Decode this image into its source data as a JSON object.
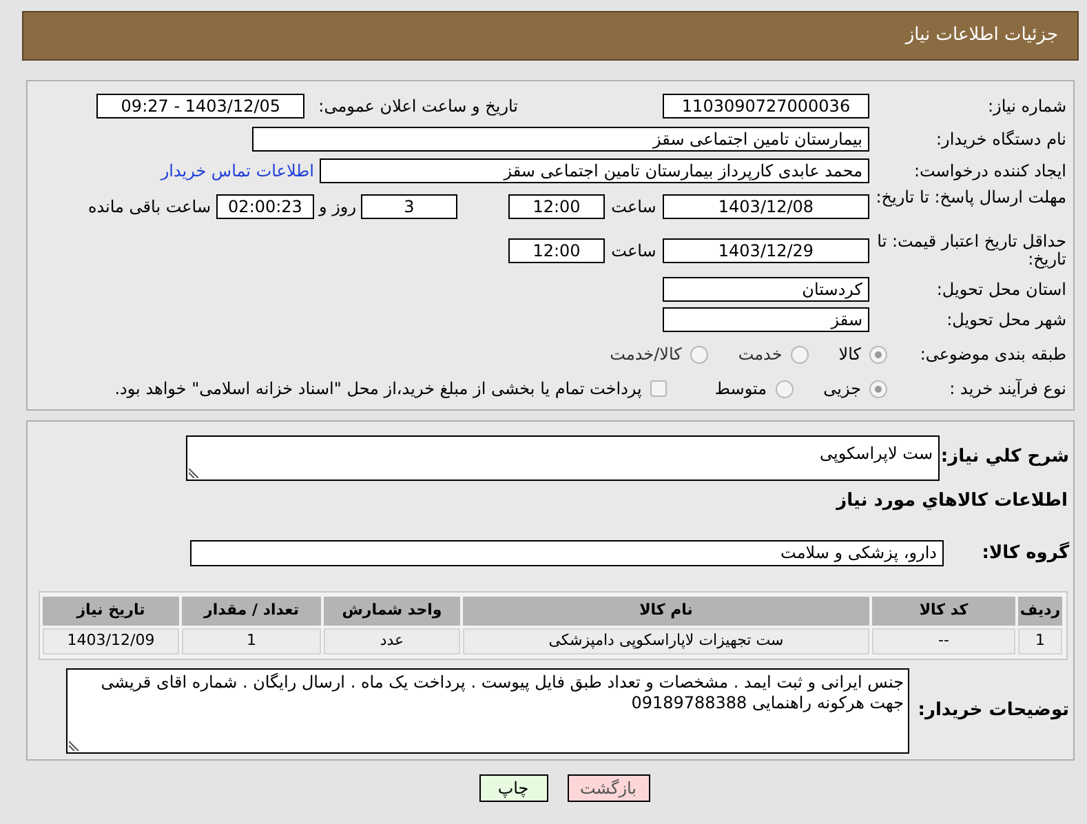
{
  "header": {
    "title": "جزئیات اطلاعات نیاز"
  },
  "need_number": {
    "label": "شماره نیاز:",
    "value": "1103090727000036"
  },
  "announce": {
    "label": "تاریخ و ساعت اعلان عمومی:",
    "value": "1403/12/05 - 09:27"
  },
  "buyer_org": {
    "label": "نام دستگاه خریدار:",
    "value": "بیمارستان تامین اجتماعی سقز"
  },
  "requester": {
    "label": "ایجاد کننده درخواست:",
    "value": "محمد عابدی کارپرداز بیمارستان تامین اجتماعی سقز",
    "link": "اطلاعات تماس خریدار"
  },
  "reply_deadline": {
    "label": "مهلت ارسال پاسخ: تا تاریخ:",
    "date": "1403/12/08",
    "time_label": "ساعت",
    "time": "12:00",
    "days": "3",
    "days_label": "روز و",
    "remaining": "02:00:23",
    "remaining_label": "ساعت باقی مانده"
  },
  "price_validity": {
    "label": "حداقل تاریخ اعتبار قیمت: تا تاریخ:",
    "date": "1403/12/29",
    "time_label": "ساعت",
    "time": "12:00"
  },
  "province": {
    "label": "استان محل تحویل:",
    "value": "کردستان"
  },
  "city": {
    "label": "شهر محل تحویل:",
    "value": "سقز"
  },
  "category": {
    "label": "طبقه بندی موضوعی:",
    "options": [
      {
        "label": "کالا",
        "selected": true
      },
      {
        "label": "خدمت",
        "selected": false
      },
      {
        "label": "کالا/خدمت",
        "selected": false
      }
    ]
  },
  "process": {
    "label": "نوع فرآیند خرید :",
    "options": [
      {
        "label": "جزیی",
        "selected": true
      },
      {
        "label": "متوسط",
        "selected": false
      }
    ],
    "payment_note": {
      "checked": false,
      "text": "پرداخت تمام یا بخشی از مبلغ خرید،از محل \"اسناد خزانه اسلامی\" خواهد بود."
    }
  },
  "summary": {
    "label": "شرح کلي نياز:",
    "value": "ست لاپراسکوپی"
  },
  "goods_heading": "اطلاعات کالاهاي مورد نياز",
  "goods_group": {
    "label": "گروه کالا:",
    "value": "دارو، پزشکی و سلامت"
  },
  "table": {
    "columns": [
      "ردیف",
      "کد کالا",
      "نام کالا",
      "واحد شمارش",
      "تعداد / مقدار",
      "تاریخ نیاز"
    ],
    "rows": [
      [
        "1",
        "--",
        "ست تجهیزات لاپاراسکوپی دامپزشکی",
        "عدد",
        "1",
        "1403/12/09"
      ]
    ]
  },
  "buyer_notes": {
    "label": "توضیحات خریدار:",
    "value": "جنس ایرانی و ثبت ایمد . مشخصات و تعداد طبق فایل پیوست . پرداخت یک ماه . ارسال رایگان . شماره اقای قریشی جهت هرکونه راهنمایی 09189788388"
  },
  "buttons": [
    {
      "label": "بازگشت",
      "kind": "back"
    },
    {
      "label": "چاپ",
      "kind": "print"
    }
  ]
}
